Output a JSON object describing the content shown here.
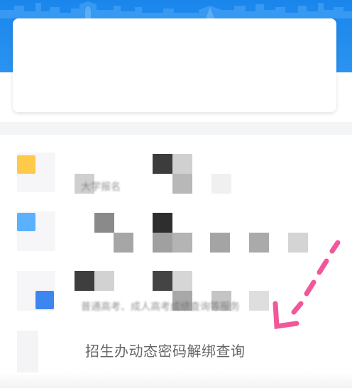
{
  "header": {
    "background_color": "#1a86ec"
  },
  "rows": {
    "row1_text": "大学报名",
    "row3_text": "普通高考、成人高考成绩查询等服务"
  },
  "main_link": {
    "label": "招生办动态密码解绑查询"
  },
  "colors": {
    "icon_yellow": "#ffc94a",
    "icon_light_blue": "#5cb1ff",
    "icon_blue": "#3d86f0",
    "annotation_pink": "#f0589a"
  }
}
